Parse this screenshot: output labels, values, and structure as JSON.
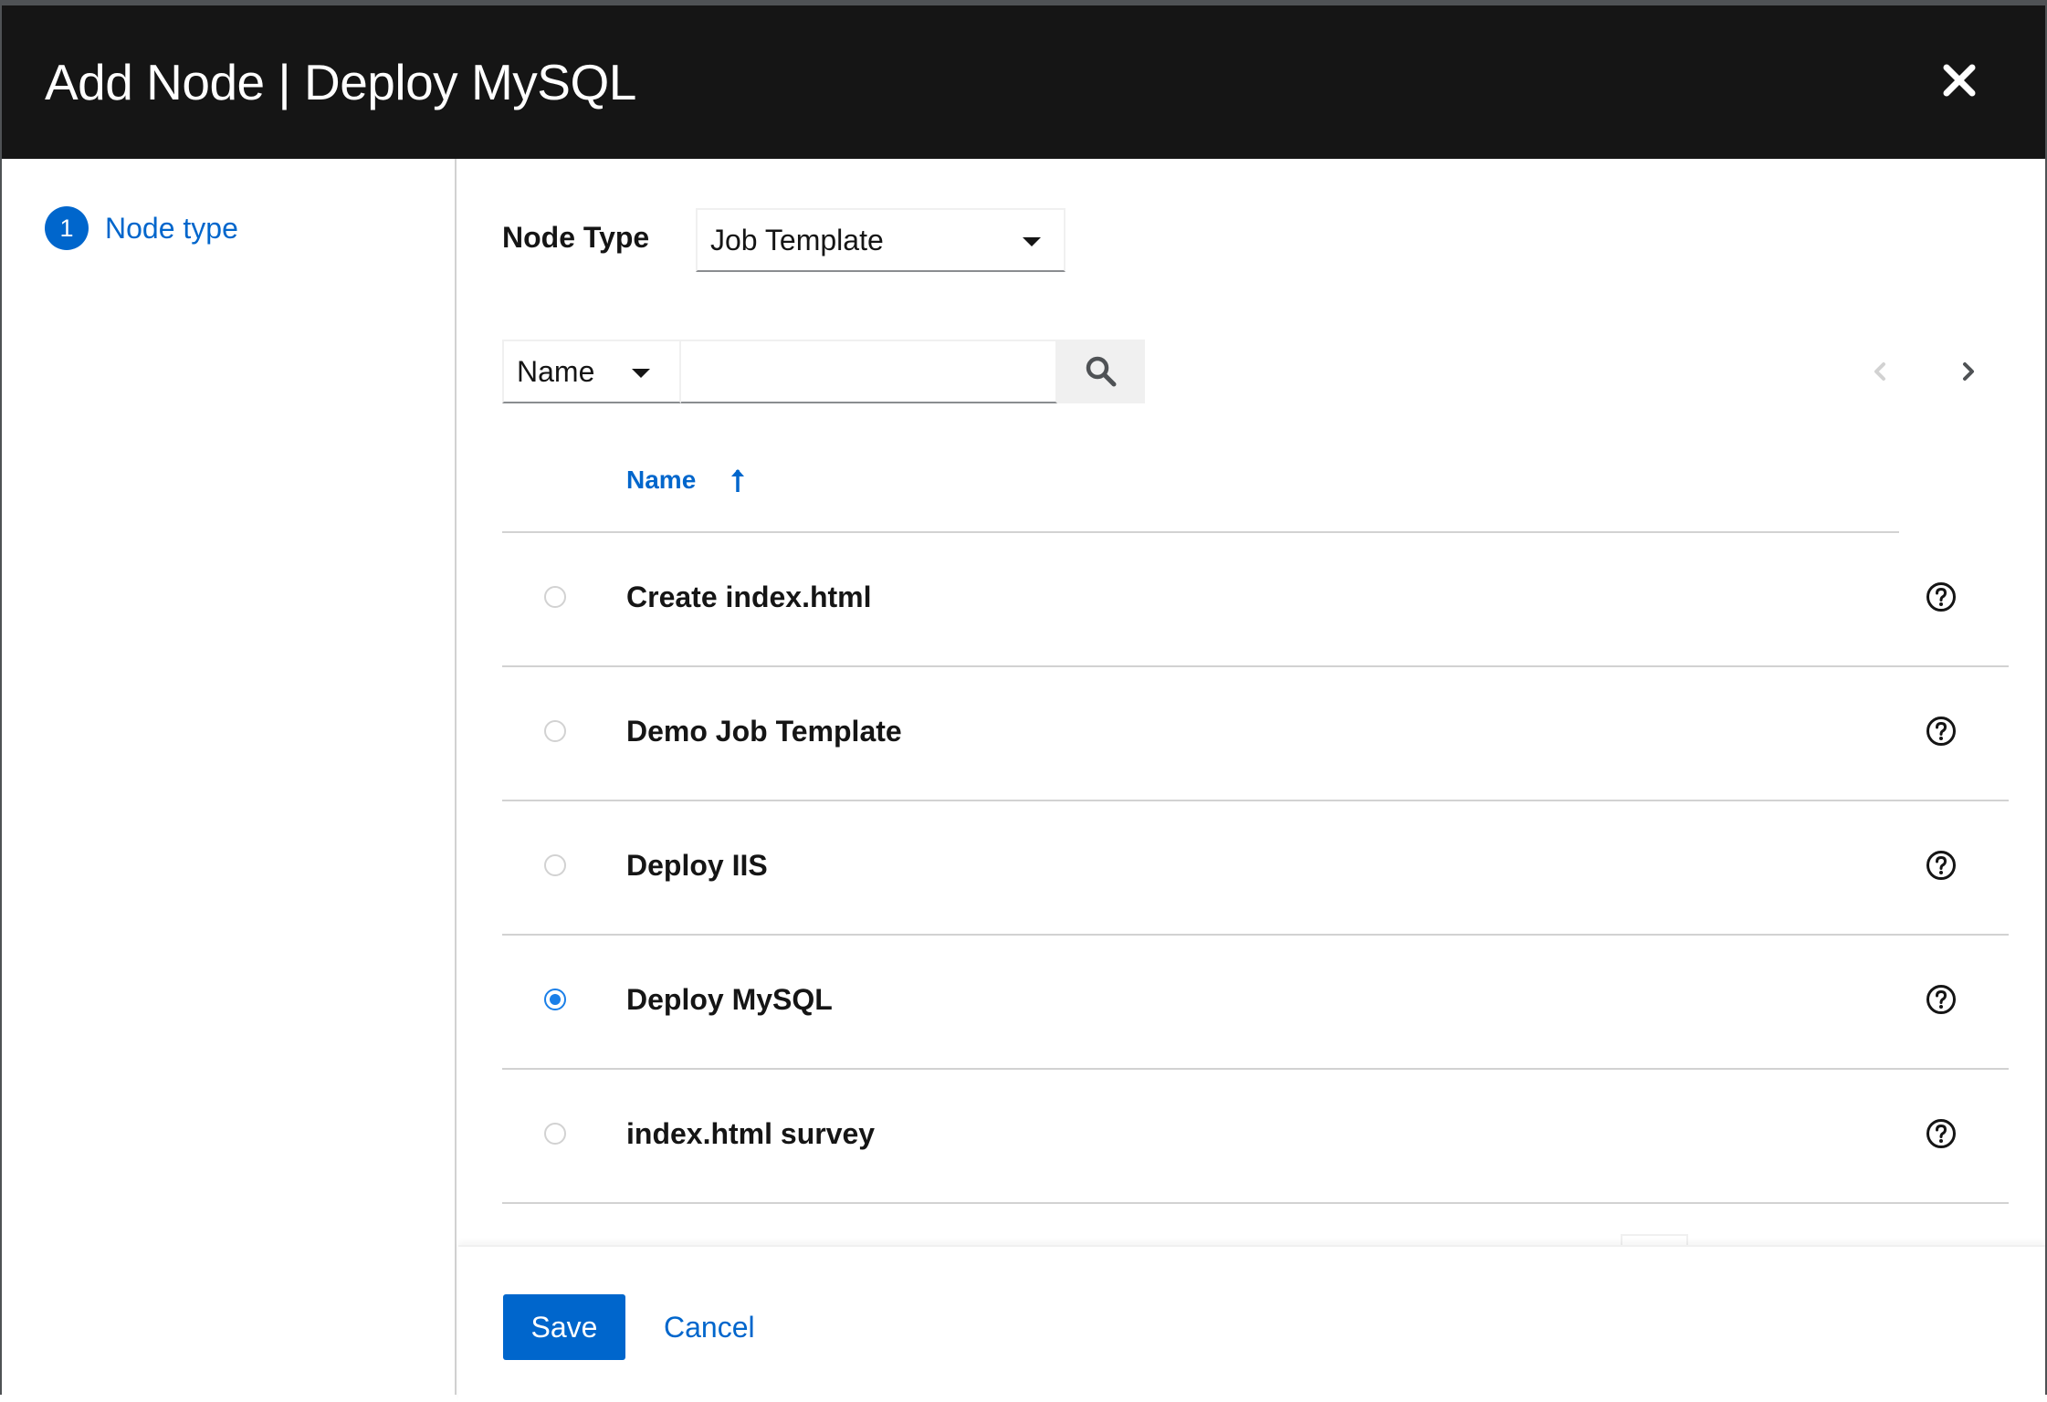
{
  "modal": {
    "title": "Add Node | Deploy MySQL"
  },
  "wizard": {
    "steps": [
      {
        "number": "1",
        "label": "Node type"
      }
    ]
  },
  "form": {
    "node_type_label": "Node Type",
    "node_type_value": "Job Template"
  },
  "search": {
    "filter_value": "Name",
    "query": ""
  },
  "table": {
    "column_header": "Name",
    "sort": "ascending",
    "rows": [
      {
        "name": "Create index.html",
        "selected": false
      },
      {
        "name": "Demo Job Template",
        "selected": false
      },
      {
        "name": "Deploy IIS",
        "selected": false
      },
      {
        "name": "Deploy MySQL",
        "selected": true
      },
      {
        "name": "index.html survey",
        "selected": false
      }
    ]
  },
  "footer": {
    "save_label": "Save",
    "cancel_label": "Cancel"
  },
  "colors": {
    "header_bg": "#151515",
    "accent": "#0066cc",
    "radio_checked": "#1a7fe8"
  }
}
